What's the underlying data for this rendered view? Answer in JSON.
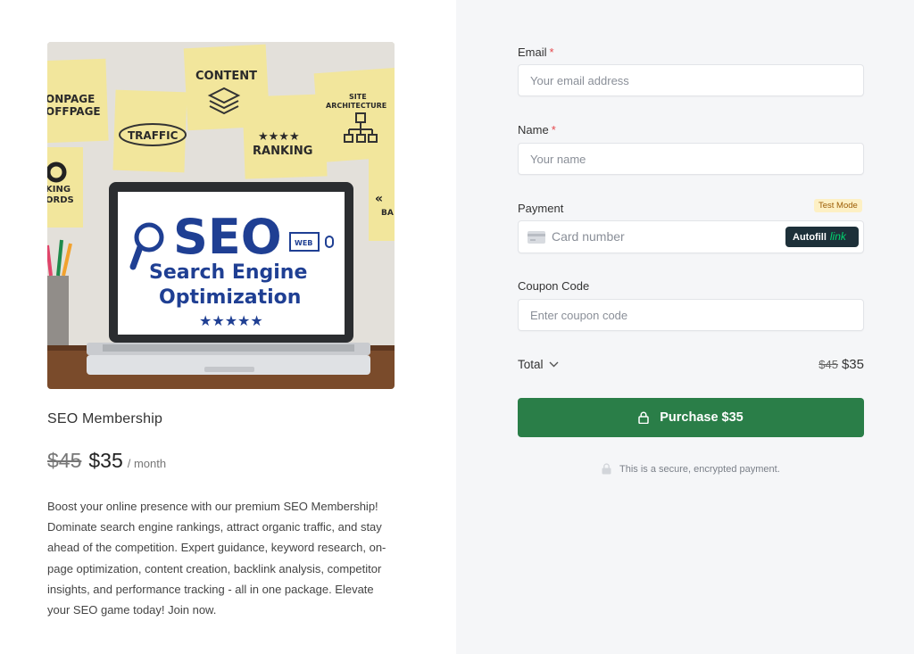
{
  "product": {
    "name": "SEO Membership",
    "price_old": "$45",
    "price_new": "$35",
    "period": "/ month",
    "description": "Boost your online presence with our premium SEO Membership! Dominate search engine rankings, attract organic traffic, and stay ahead of the competition. Expert guidance, keyword research, on-page optimization, content creation, backlink analysis, competitor insights, and performance tracking - all in one package. Elevate your SEO game today! Join now.",
    "image": {
      "note1": "ONPAGE",
      "note1b": "OFFPAGE",
      "note2": "CONTENT",
      "note3": "TRAFFIC",
      "note4": "★★★★",
      "note4b": "RANKING",
      "note5": "SITE",
      "note5b": "ARCHITECTURE",
      "note6": "KING",
      "note6b": "ORDS",
      "note7": "BA",
      "screen_big": "SEO",
      "screen_line1": "Search Engine",
      "screen_line2": "Optimization",
      "screen_stars": "★★★★★",
      "screen_web": "WEB"
    }
  },
  "form": {
    "email": {
      "label": "Email",
      "required_mark": "*",
      "placeholder": "Your email address"
    },
    "name": {
      "label": "Name",
      "required_mark": "*",
      "placeholder": "Your name"
    },
    "payment": {
      "label": "Payment",
      "badge": "Test Mode",
      "card_placeholder": "Card number",
      "autofill_label": "Autofill",
      "autofill_link": "link"
    },
    "coupon": {
      "label": "Coupon Code",
      "placeholder": "Enter coupon code"
    },
    "total": {
      "label": "Total",
      "old": "$45",
      "new": "$35"
    },
    "purchase_label": "Purchase $35",
    "secure_note": "This is a secure, encrypted payment."
  },
  "colors": {
    "primary_button": "#2a7e48",
    "required": "#e5484d",
    "right_panel_bg": "#f5f6f8",
    "badge_bg": "#fdf0c4"
  }
}
